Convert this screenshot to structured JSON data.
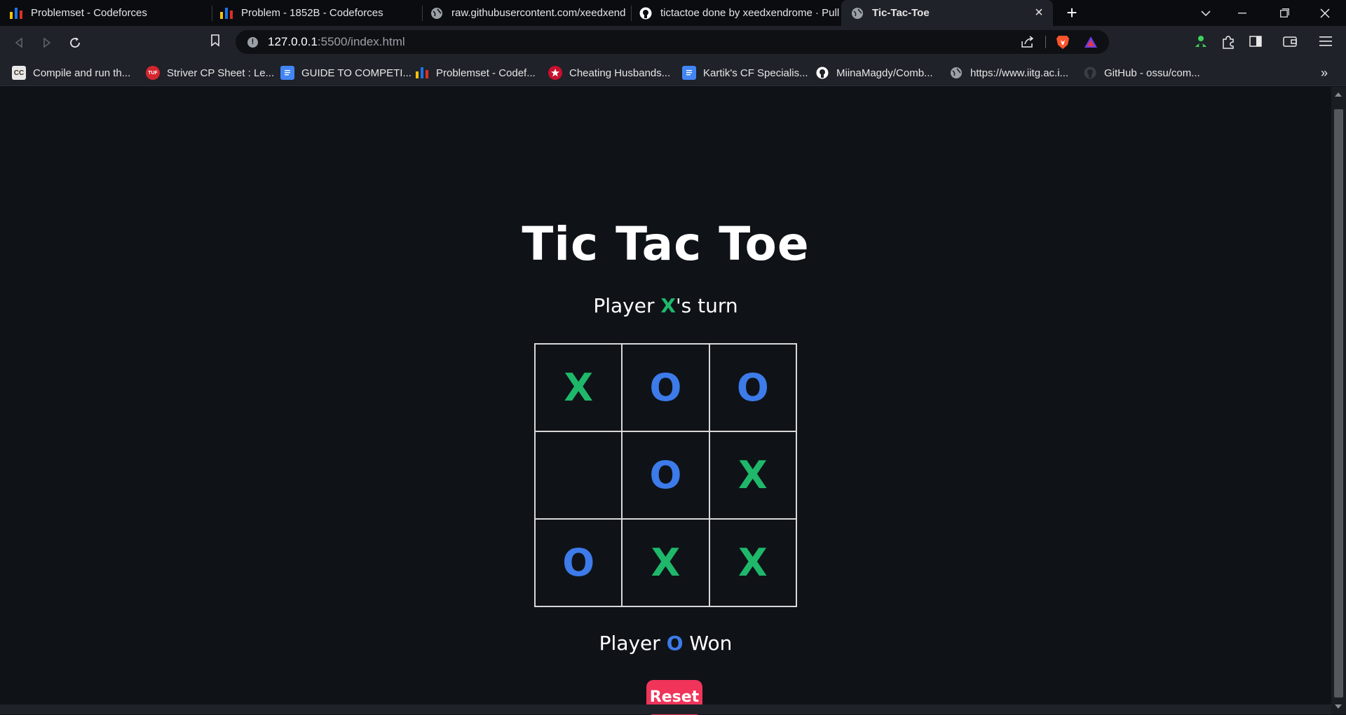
{
  "tabs": [
    {
      "title": "Problemset - Codeforces",
      "icon": "codeforces-icon"
    },
    {
      "title": "Problem - 1852B - Codeforces",
      "icon": "codeforces-icon"
    },
    {
      "title": "raw.githubusercontent.com/xeedxend",
      "icon": "globe-icon"
    },
    {
      "title": "tictactoe done by xeedxendrome · Pull",
      "icon": "github-icon"
    },
    {
      "title": "Tic-Tac-Toe",
      "icon": "globe-icon",
      "active": true
    }
  ],
  "address_bar": {
    "host": "127.0.0.1",
    "rest": ":5500/index.html"
  },
  "bookmarks": [
    {
      "label": "Compile and run th...",
      "icon": "cc-icon"
    },
    {
      "label": "Striver CP Sheet : Le...",
      "icon": "tuf-icon"
    },
    {
      "label": "GUIDE TO COMPETI...",
      "icon": "doc-icon"
    },
    {
      "label": "Problemset - Codef...",
      "icon": "codeforces-icon"
    },
    {
      "label": "Cheating Husbands...",
      "icon": "star-icon"
    },
    {
      "label": "Kartik's CF Specialis...",
      "icon": "doc-icon"
    },
    {
      "label": "MiinaMagdy/Comb...",
      "icon": "github-icon"
    },
    {
      "label": "https://www.iitg.ac.i...",
      "icon": "globe-icon"
    },
    {
      "label": "GitHub - ossu/com...",
      "icon": "github-icon"
    }
  ],
  "bookmarks_overflow": "»",
  "game": {
    "title": "Tic Tac Toe",
    "turn_prefix": "Player ",
    "turn_mark": "X",
    "turn_suffix": "'s turn",
    "board": [
      "X",
      "O",
      "O",
      "",
      "O",
      "X",
      "O",
      "X",
      "X"
    ],
    "result_prefix": "Player ",
    "result_mark": "O",
    "result_suffix": " Won",
    "reset_label": "Reset"
  },
  "colors": {
    "x_color": "#1fb86b",
    "o_color": "#3d7bea",
    "reset_bg": "#f0345a",
    "page_bg": "#0f1318"
  }
}
